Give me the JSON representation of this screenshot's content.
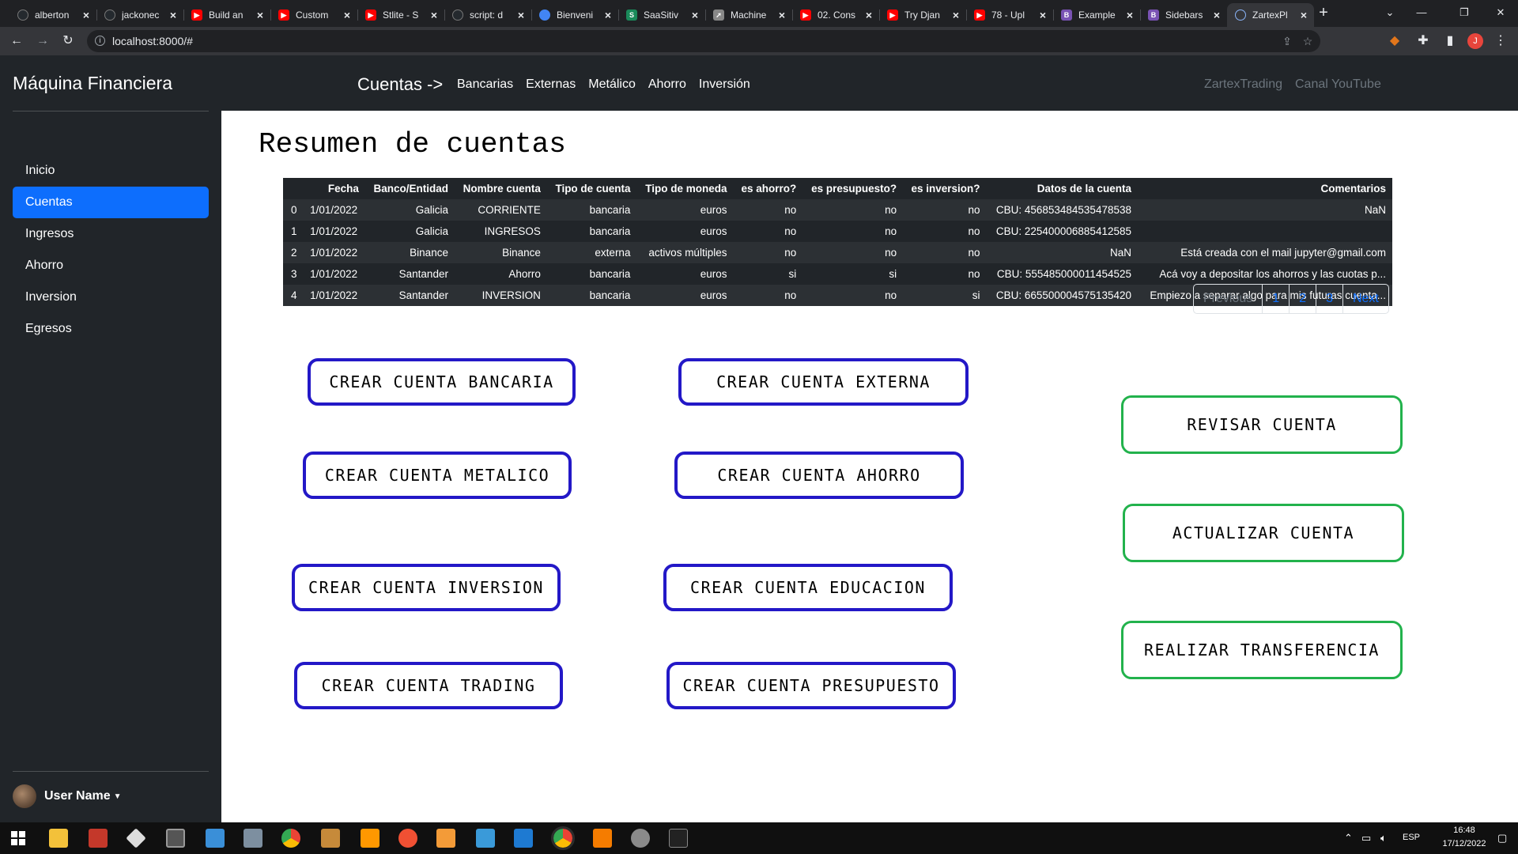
{
  "browser": {
    "tabs": [
      {
        "title": "alberton",
        "favicon": "github-icon",
        "color": "#24292e"
      },
      {
        "title": "jackonec",
        "favicon": "github-icon",
        "color": "#24292e"
      },
      {
        "title": "Build an",
        "favicon": "youtube-icon",
        "color": "#ff0000"
      },
      {
        "title": "Custom",
        "favicon": "youtube-icon",
        "color": "#ff0000"
      },
      {
        "title": "Stlite - S",
        "favicon": "youtube-icon",
        "color": "#ff0000"
      },
      {
        "title": "script: d",
        "favicon": "github-icon",
        "color": "#24292e"
      },
      {
        "title": "Bienveni",
        "favicon": "cloud-icon",
        "color": "#4285f4"
      },
      {
        "title": "SaaSitiv",
        "favicon": "s-icon",
        "color": "#1a8a5a"
      },
      {
        "title": "Machine",
        "favicon": "rocket-icon",
        "color": "#888888"
      },
      {
        "title": "02. Cons",
        "favicon": "youtube-icon",
        "color": "#ff0000"
      },
      {
        "title": "Try Djan",
        "favicon": "youtube-icon",
        "color": "#ff0000"
      },
      {
        "title": "78 - Upl",
        "favicon": "youtube-icon",
        "color": "#ff0000"
      },
      {
        "title": "Example",
        "favicon": "bootstrap-icon",
        "color": "#7952b3"
      },
      {
        "title": "Sidebars",
        "favicon": "bootstrap-icon",
        "color": "#7952b3"
      },
      {
        "title": "ZartexPl",
        "favicon": "globe-icon",
        "color": "#8ab4f8"
      }
    ],
    "active_tab": 14,
    "url": "localhost:8000/#"
  },
  "brand": "Máquina Financiera",
  "sidebar": {
    "items": [
      "Inicio",
      "Cuentas",
      "Ingresos",
      "Ahorro",
      "Inversion",
      "Egresos"
    ],
    "active": 1,
    "user_name": "User Name"
  },
  "topnav": {
    "cuentas_label": "Cuentas ->",
    "links": [
      "Bancarias",
      "Externas",
      "Metálico",
      "Ahorro",
      "Inversión"
    ],
    "external": [
      "ZartexTrading",
      "Canal YouTube"
    ]
  },
  "main": {
    "title": "Resumen de cuentas",
    "table": {
      "columns": [
        "",
        "Fecha",
        "Banco/Entidad",
        "Nombre cuenta",
        "Tipo de cuenta",
        "Tipo de moneda",
        "es ahorro?",
        "es presupuesto?",
        "es inversion?",
        "Datos de la cuenta",
        "Comentarios"
      ],
      "rows": [
        [
          "0",
          "1/01/2022",
          "Galicia",
          "CORRIENTE",
          "bancaria",
          "euros",
          "no",
          "no",
          "no",
          "CBU: 456853484535478538",
          "NaN"
        ],
        [
          "1",
          "1/01/2022",
          "Galicia",
          "INGRESOS",
          "bancaria",
          "euros",
          "no",
          "no",
          "no",
          "CBU: 225400006885412585",
          ""
        ],
        [
          "2",
          "1/01/2022",
          "Binance",
          "Binance",
          "externa",
          "activos múltiples",
          "no",
          "no",
          "no",
          "NaN",
          "Está creada con el mail jupyter@gmail.com"
        ],
        [
          "3",
          "1/01/2022",
          "Santander",
          "Ahorro",
          "bancaria",
          "euros",
          "si",
          "si",
          "no",
          "CBU: 555485000011454525",
          "Acá voy a depositar los ahorros y las cuotas p..."
        ],
        [
          "4",
          "1/01/2022",
          "Santander",
          "INVERSION",
          "bancaria",
          "euros",
          "no",
          "no",
          "si",
          "CBU: 665500004575135420",
          "Empiezo a separar algo para mis futuras cuenta..."
        ]
      ]
    },
    "pagination": {
      "previous": "Previous",
      "pages": [
        "1",
        "2",
        "3"
      ],
      "next": "Next"
    },
    "create_buttons": [
      "CREAR CUENTA BANCARIA",
      "CREAR CUENTA EXTERNA",
      "CREAR CUENTA METALICO",
      "CREAR CUENTA AHORRO",
      "CREAR CUENTA INVERSION",
      "CREAR CUENTA EDUCACION",
      "CREAR CUENTA TRADING",
      "CREAR CUENTA PRESUPUESTO"
    ],
    "action_buttons": [
      "REVISAR CUENTA",
      "ACTUALIZAR CUENTA",
      "REALIZAR TRANSFERENCIA"
    ]
  },
  "taskbar": {
    "language": "ESP",
    "time": "16:48",
    "date": "17/12/2022"
  }
}
